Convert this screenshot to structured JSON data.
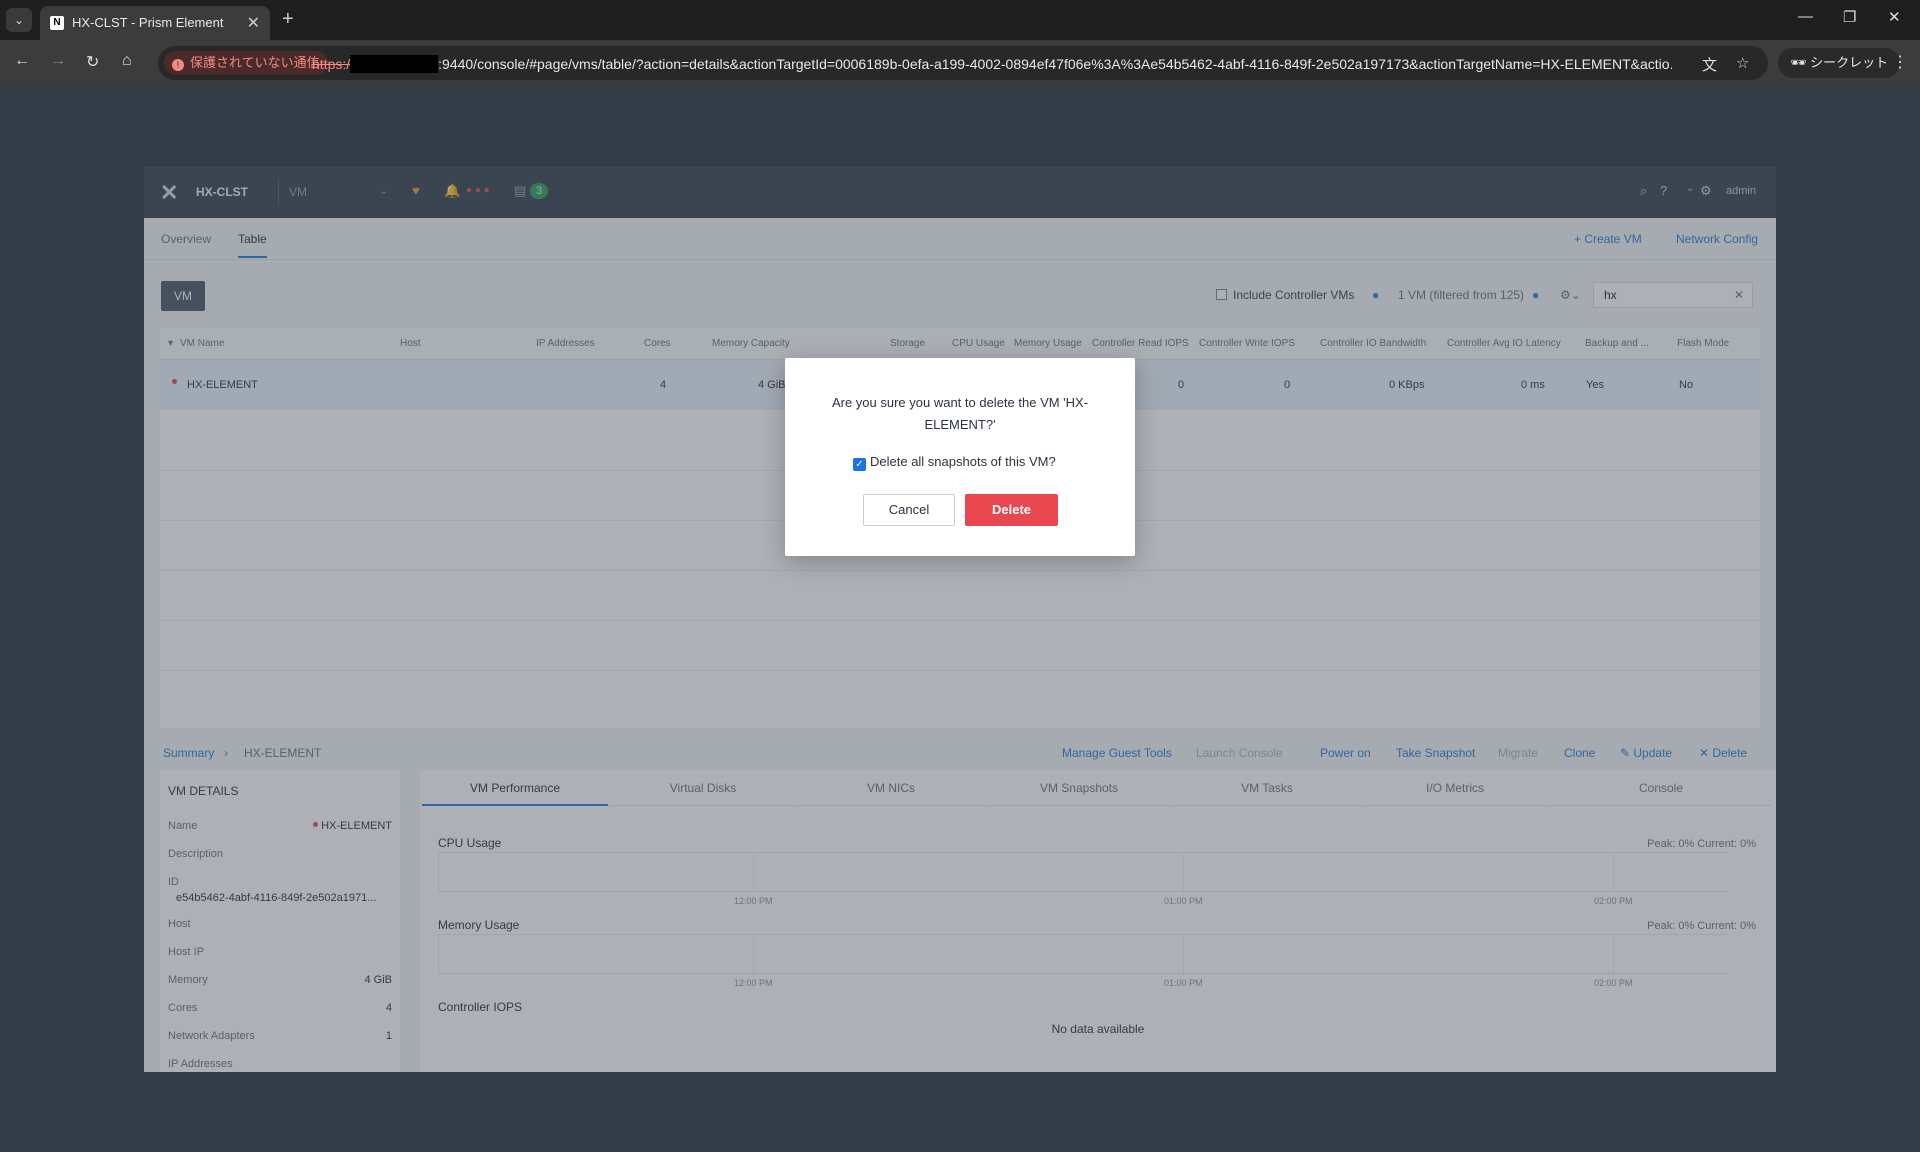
{
  "browser": {
    "tab_title": "HX-CLST - Prism Element",
    "tab_favicon": "N",
    "security_label": "保護されていない通信",
    "url_scheme": "https:/",
    "url_rest": ":9440/console/#page/vms/table/?action=details&actionTargetId=0006189b-0efa-a199-4002-0894ef47f06e%3A%3Ae54b5462-4abf-4116-849f-2e502a197173&actionTargetName=HX-ELEMENT&actio...",
    "incognito_label": "シークレット"
  },
  "app": {
    "cluster_name": "HX-CLST",
    "section": "VM",
    "task_count": "3",
    "user": "admin",
    "tabs": [
      "Overview",
      "Table"
    ],
    "create_vm": "+ Create VM",
    "network_config": "Network Config"
  },
  "filters": {
    "entity_pill": "VM",
    "include_controller": "Include Controller VMs",
    "count_text": "1 VM (filtered from 125)",
    "search_value": "hx"
  },
  "table": {
    "columns": [
      "VM Name",
      "Host",
      "IP Addresses",
      "Cores",
      "Memory Capacity",
      "Storage",
      "CPU Usage",
      "Memory Usage",
      "Controller Read IOPS",
      "Controller Write IOPS",
      "Controller IO Bandwidth",
      "Controller Avg IO Latency",
      "Backup and ...",
      "Flash Mode"
    ],
    "row": {
      "name": "HX-ELEMENT",
      "cores": "4",
      "memory": "4 GiB",
      "read_iops": "0",
      "write_iops": "0",
      "bandwidth": "0 KBps",
      "latency": "0 ms",
      "backup": "Yes",
      "flash": "No"
    }
  },
  "actions_bar": {
    "breadcrumb_root": "Summary",
    "breadcrumb_item": "HX-ELEMENT",
    "actions": [
      "Manage Guest Tools",
      "Launch Console",
      "Power on",
      "Take Snapshot",
      "Migrate",
      "Clone",
      "Update",
      "Delete"
    ]
  },
  "details": {
    "header": "VM DETAILS",
    "name_label": "Name",
    "name_value": "HX-ELEMENT",
    "description_label": "Description",
    "id_label": "ID",
    "id_value": "e54b5462-4abf-4116-849f-2e502a1971...",
    "host_label": "Host",
    "host_ip_label": "Host IP",
    "memory_label": "Memory",
    "memory_value": "4 GiB",
    "cores_label": "Cores",
    "cores_value": "4",
    "adapters_label": "Network Adapters",
    "adapters_value": "1",
    "ip_label": "IP Addresses"
  },
  "perf": {
    "tabs": [
      "VM Performance",
      "Virtual Disks",
      "VM NICs",
      "VM Snapshots",
      "VM Tasks",
      "I/O Metrics",
      "Console"
    ],
    "cpu_label": "CPU Usage",
    "cpu_stat": "Peak: 0%  Current: 0%",
    "mem_label": "Memory Usage",
    "mem_stat": "Peak: 0%  Current: 0%",
    "ticks": [
      "12:00 PM",
      "01:00 PM",
      "02:00 PM"
    ],
    "iops_label": "Controller IOPS",
    "no_data": "No data available"
  },
  "modal": {
    "message": "Are you sure you want to delete the VM 'HX-ELEMENT?'",
    "checkbox_label": "Delete all snapshots of this VM?",
    "checkbox_checked": true,
    "cancel_label": "Cancel",
    "delete_label": "Delete"
  },
  "colors": {
    "delete_button": "#e9474f",
    "accent_link": "#2e7cd6",
    "header_bg": "#3b4452"
  }
}
